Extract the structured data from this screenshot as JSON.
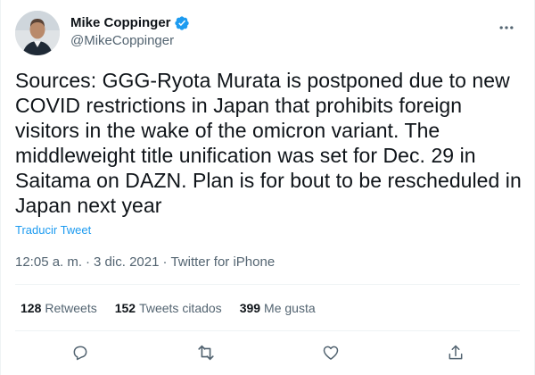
{
  "author": {
    "display_name": "Mike Coppinger",
    "handle": "@MikeCoppinger",
    "verified": true
  },
  "tweet": {
    "text": "Sources: GGG-Ryota Murata is postponed due to new COVID restrictions in Japan that prohibits foreign visitors in the wake of the omicron variant. The middleweight title unification was set for Dec. 29 in Saitama on DAZN. Plan is for bout to be rescheduled in Japan next year",
    "translate_label": "Traducir Tweet",
    "time": "12:05 a. m.",
    "separator": "·",
    "date": "3 dic. 2021",
    "source": "Twitter for iPhone"
  },
  "stats": {
    "retweets_count": "128",
    "retweets_label": "Retweets",
    "quotes_count": "152",
    "quotes_label": "Tweets citados",
    "likes_count": "399",
    "likes_label": "Me gusta"
  },
  "icons": {
    "reply": "reply-icon",
    "retweet": "retweet-icon",
    "like": "heart-icon",
    "share": "share-icon",
    "more": "more-options-icon",
    "verified": "verified-badge-icon"
  },
  "colors": {
    "accent": "#1d9bf0",
    "text": "#0f1419",
    "secondary": "#536471",
    "divider": "#eff3f4"
  }
}
